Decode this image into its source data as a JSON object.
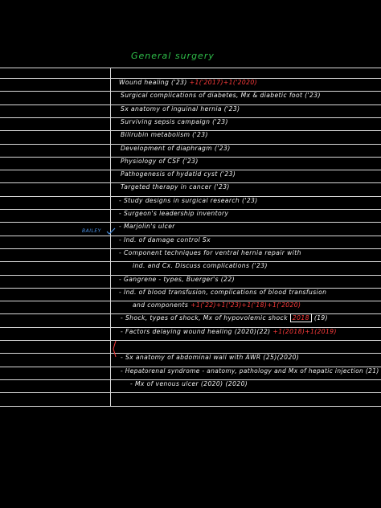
{
  "title": "General surgery",
  "margin_note": "BAILEY",
  "colors": {
    "title": "#2fbf4a",
    "ink": "#f2f2f2",
    "highlight": "#ff3b3b",
    "margin_note": "#4a90e2",
    "rule": "#d9d9d9"
  },
  "entries": [
    {
      "text": "Wound healing ('23)",
      "red": "+1('2017)+1('2020)"
    },
    {
      "text": "Surgical complications of diabetes, Mx & diabetic foot ('23)"
    },
    {
      "text": "Sx anatomy of inguinal hernia ('23)"
    },
    {
      "text": "Surviving sepsis campaign ('23)"
    },
    {
      "text": "Bilirubin metabolism ('23)"
    },
    {
      "text": "Development of diaphragm ('23)"
    },
    {
      "text": "Physiology of CSF ('23)"
    },
    {
      "text": "Pathogenesis of hydatid cyst ('23)"
    },
    {
      "text": "Targeted therapy in cancer ('23)"
    },
    {
      "text": "- Study designs in surgical research ('23)"
    },
    {
      "text": "- Surgeon's leadership inventory"
    },
    {
      "text": "- Marjolin's ulcer"
    },
    {
      "text": "- Ind. of damage control Sx"
    },
    {
      "text": "- Component techniques for ventral hernia repair with"
    },
    {
      "text": "ind. and Cx. Discuss complications ('23)"
    },
    {
      "text": "- Gangrene - types, Buerger's (22)"
    },
    {
      "text": "- Ind. of blood transfusion, complications of blood transfusion"
    },
    {
      "text": "and components",
      "red": "+1('22)+1('23)+1('18)+1('2020)"
    },
    {
      "text": "- Shock, types of shock, Mx of hypovolemic shock",
      "boxed": "2018",
      "tail": "(19)"
    },
    {
      "text": "- Factors delaying wound healing (2020)(22)",
      "red": "+1(2018)+1(2019)"
    },
    {
      "text": ""
    },
    {
      "text": "- Sx anatomy of abdominal wall with AWR (25)(2020)"
    },
    {
      "text": "- Hepatorenal syndrome - anatomy, pathology and Mx of hepatic injection (21)"
    },
    {
      "text": "- Mx of venous ulcer (2020)",
      "tail": "(2020)"
    }
  ]
}
